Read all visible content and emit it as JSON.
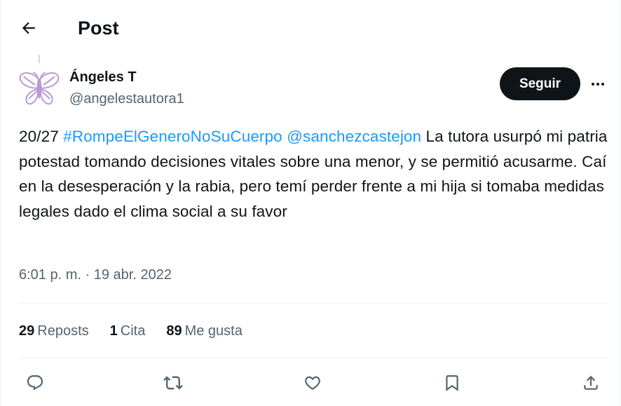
{
  "header": {
    "title": "Post",
    "back_icon": "arrow-left-icon"
  },
  "author": {
    "name": "Ángeles T",
    "handle": "@angelestautora1",
    "avatar_icon": "butterfly-avatar",
    "avatar_color": "#b89ad6"
  },
  "follow_button": {
    "label": "Seguir"
  },
  "more_icon": "more-horizontal-icon",
  "tweet": {
    "prefix": "20/27",
    "hashtag": "#RompeElGeneroNoSuCuerpo",
    "mention": "@sanchezcastejon",
    "body": "La tutora usurpó mi patria potestad tomando decisiones vitales sobre una menor, y se permitió acusarme. Caí en la desesperación y la rabia, pero temí perder frente a mi hija si tomaba medidas legales dado el clima social a su favor",
    "link_color": "#1d9bf0"
  },
  "timestamp": {
    "time": "6:01 p. m.",
    "separator": "·",
    "date": "19 abr. 2022"
  },
  "stats": {
    "reposts_count": "29",
    "reposts_label": "Reposts",
    "quotes_count": "1",
    "quotes_label": "Cita",
    "likes_count": "89",
    "likes_label": "Me gusta"
  },
  "actions": [
    {
      "icon": "reply-icon"
    },
    {
      "icon": "repost-icon"
    },
    {
      "icon": "like-icon"
    },
    {
      "icon": "bookmark-icon"
    },
    {
      "icon": "share-icon"
    }
  ]
}
